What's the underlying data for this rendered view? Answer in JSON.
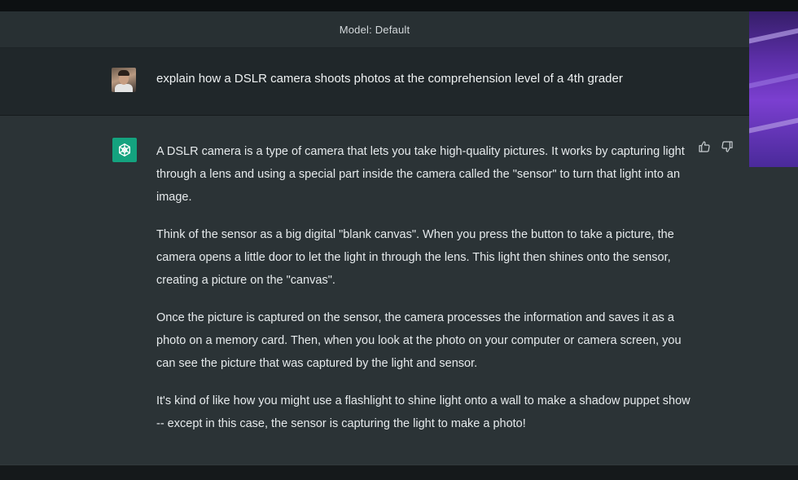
{
  "header": {
    "model_label": "Model: Default"
  },
  "conversation": {
    "user_message": "explain how a DSLR camera shoots photos at the comprehension level of a 4th grader",
    "assistant_paragraphs": [
      "A DSLR camera is a type of camera that lets you take high-quality pictures. It works by capturing light through a lens and using a special part inside the camera called the \"sensor\" to turn that light into an image.",
      "Think of the sensor as a big digital \"blank canvas\". When you press the button to take a picture, the camera opens a little door to let the light in through the lens. This light then shines onto the sensor, creating a picture on the \"canvas\".",
      "Once the picture is captured on the sensor, the camera processes the information and saves it as a photo on a memory card. Then, when you look at the photo on your computer or camera screen, you can see the picture that was captured by the light and sensor.",
      "It's kind of like how you might use a flashlight to shine light onto a wall to make a shadow puppet show -- except in this case, the sensor is capturing the light to make a photo!"
    ]
  },
  "icons": {
    "assistant_logo": "openai-logo-icon",
    "thumbs_up": "thumbs-up-icon",
    "thumbs_down": "thumbs-down-icon"
  },
  "colors": {
    "assistant_logo_bg": "#14a37f",
    "assistant_row_bg": "#2b3336",
    "user_row_bg": "#20272a",
    "header_bg": "#283033"
  }
}
